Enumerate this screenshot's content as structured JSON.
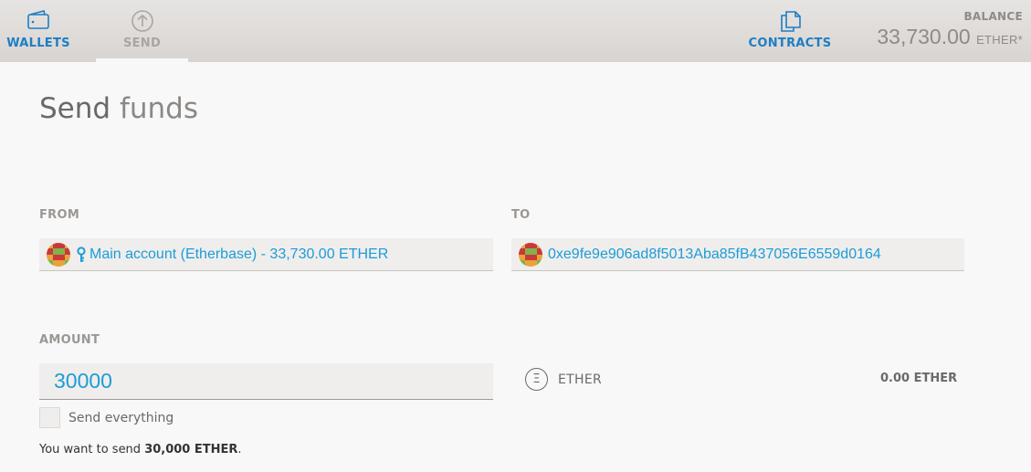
{
  "nav": {
    "wallets": "WALLETS",
    "send": "SEND",
    "contracts": "CONTRACTS"
  },
  "balance": {
    "label": "BALANCE",
    "value": "33,730.00",
    "unit": "ETHER*"
  },
  "page": {
    "title_strong": "Send",
    "title_light": "funds"
  },
  "form": {
    "from_label": "FROM",
    "to_label": "TO",
    "amount_label": "AMOUNT",
    "from_account": "Main account (Etherbase) - 33,730.00 ETHER",
    "to_address": "0xe9fe9e906ad8f5013Aba85fB437056E6559d0164",
    "amount_value": "30000",
    "currency_symbol": "Ξ",
    "currency": "ETHER",
    "fee": "0.00 ETHER",
    "send_everything_label": "Send everything",
    "summary_prefix": "You want to send ",
    "summary_amount": "30,000 ETHER",
    "summary_suffix": "."
  },
  "icons": {
    "wallets": "wallet-icon",
    "send": "arrow-up-circle-icon",
    "contracts": "contract-document-icon",
    "from": "identicon-icon",
    "key": "key-icon",
    "to": "identicon-icon",
    "currency": "ether-icon"
  },
  "colors": {
    "accent": "#1d9cd8",
    "nav_active": "#1d7ec2",
    "nav_inactive": "#a9a5a2"
  }
}
